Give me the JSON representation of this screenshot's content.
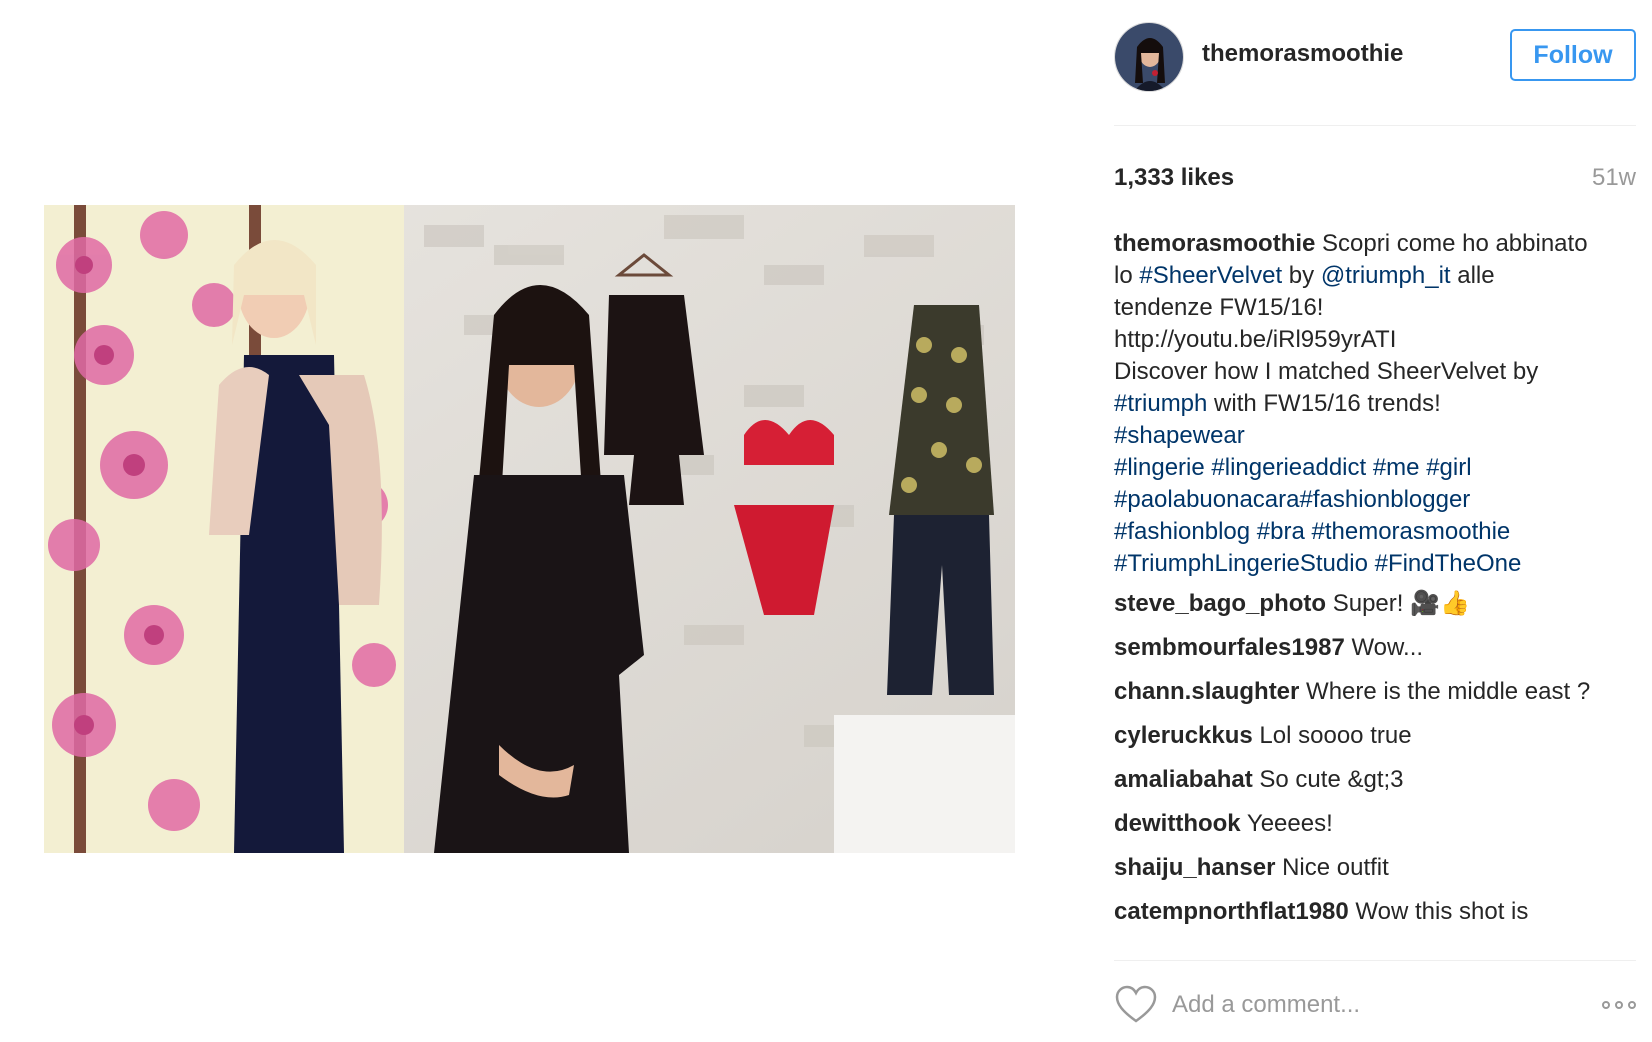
{
  "post": {
    "owner": "themorasmoothie",
    "follow_label": "Follow",
    "likes": "1,333 likes",
    "age": "51w",
    "photo_icon": "post-photo"
  },
  "caption": {
    "username": "themorasmoothie",
    "l1_text": " Scopri come ho abbinato",
    "l2_a": "lo ",
    "l2_tag1": "#SheerVelvet",
    "l2_b": " by ",
    "l2_tag2": "@triumph_it",
    "l2_c": " alle",
    "l3": "tendenze FW15/16!",
    "l4": "http://youtu.be/iRl959yrATI",
    "l5": "Discover how I matched SheerVelvet by",
    "l6_tag": "#triumph",
    "l6_text": " with FW15/16 trends!",
    "l7_tag": "#shapewear",
    "l8_tags": "#lingerie #lingerieaddict #me #girl",
    "l9_tags": "#paolabuonacara#fashionblogger",
    "l10_tags": "#fashionblog #bra #themorasmoothie",
    "l11_tags": "#TriumphLingerieStudio #FindTheOne"
  },
  "comments": [
    {
      "user": "steve_bago_photo",
      "text": " Super! 🎥👍"
    },
    {
      "user": "sembmourfales1987",
      "text": " Wow..."
    },
    {
      "user": "chann.slaughter",
      "text": " Where is the middle east ?"
    },
    {
      "user": "cyleruckkus",
      "text": " Lol soooo true"
    },
    {
      "user": "amaliabahat",
      "text": " So cute &gt;3"
    },
    {
      "user": "dewitthook",
      "text": " Yeeees!"
    },
    {
      "user": "shaiju_hanser",
      "text": " Nice outfit"
    },
    {
      "user": "catempnorthflat1980",
      "text": " Wow this shot is"
    }
  ],
  "footer": {
    "add_comment_placeholder": "Add a comment...",
    "like_icon": "heart-icon",
    "more_icon": "more-options-icon"
  },
  "colors": {
    "accent": "#3897f0",
    "hashtag": "#003569",
    "muted": "#999999",
    "text": "#262626"
  }
}
